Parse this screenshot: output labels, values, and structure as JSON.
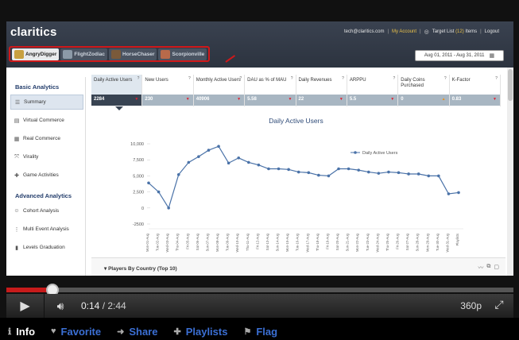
{
  "app": {
    "logo": "claritics",
    "user_email": "tech@claritics.com",
    "my_account": "My Account",
    "target_list_label": "Target List",
    "target_list_count": "(12)",
    "target_list_suffix": "Items",
    "logout": "Logout",
    "date_range": "Aug 01, 2011 - Aug 31, 2011"
  },
  "games": [
    {
      "label": "AngryDigger",
      "active": true,
      "color": "#c8a040"
    },
    {
      "label": "FlightZodiac",
      "active": false,
      "color": "#8c9aa8"
    },
    {
      "label": "HorseChaser",
      "active": false,
      "color": "#7a5a3a"
    },
    {
      "label": "Scorpionville",
      "active": false,
      "color": "#b86a4a"
    }
  ],
  "sidebar": {
    "basic_heading": "Basic Analytics",
    "basic_items": [
      {
        "label": "Summary",
        "icon": "list-icon"
      },
      {
        "label": "Virtual Commerce",
        "icon": "cart-icon"
      },
      {
        "label": "Real Commerce",
        "icon": "receipt-icon"
      },
      {
        "label": "Virality",
        "icon": "share-icon"
      },
      {
        "label": "Game Activities",
        "icon": "gamepad-icon"
      }
    ],
    "advanced_heading": "Advanced Analytics",
    "advanced_items": [
      {
        "label": "Cohort Analysis",
        "icon": "users-icon"
      },
      {
        "label": "Multi Event Analysis",
        "icon": "events-icon"
      },
      {
        "label": "Levels Graduation",
        "icon": "bars-icon"
      }
    ]
  },
  "metrics": [
    {
      "label": "Daily Active Users",
      "value": "2284",
      "trend": "down",
      "selected": true
    },
    {
      "label": "New Users",
      "value": "230",
      "trend": "down"
    },
    {
      "label": "Monthly Active Users",
      "value": "40906",
      "trend": "down"
    },
    {
      "label": "DAU as % of MAU",
      "value": "5.58",
      "trend": "down"
    },
    {
      "label": "Daily Revenues",
      "value": "22",
      "trend": "down"
    },
    {
      "label": "ARPPU",
      "value": "5.5",
      "trend": "down"
    },
    {
      "label": "Daily Coins Purchased",
      "value": "0",
      "trend": "up"
    },
    {
      "label": "K-Factor",
      "value": "0.83",
      "trend": "down"
    }
  ],
  "chart_data": {
    "type": "line",
    "title": "Daily Active Users",
    "series": [
      {
        "name": "Daily Active Users",
        "color": "#4a72a8",
        "values": [
          3900,
          2500,
          0,
          5200,
          7100,
          8000,
          9000,
          9600,
          7000,
          7800,
          7100,
          6700,
          6100,
          6100,
          6000,
          5600,
          5500,
          5100,
          5000,
          6100,
          6100,
          5900,
          5600,
          5400,
          5600,
          5500,
          5300,
          5300,
          5000,
          5000,
          2200,
          2400
        ]
      }
    ],
    "y_ticks": [
      "10,000",
      "7,500",
      "5,000",
      "2,500",
      "0",
      "-2500"
    ],
    "ylim": [
      -2500,
      10000
    ],
    "x_labels": [
      "Mon-01-Aug",
      "Tue-02-Aug",
      "Wed-03-Aug",
      "Thu-04-Aug",
      "Fri-05-Aug",
      "Sat-06-Aug",
      "Sun-07-Aug",
      "Mon-08-Aug",
      "Tue-09-Aug",
      "Wed-10-Aug",
      "Thu-11-Aug",
      "Fri-12-Aug",
      "Sat-13-Aug",
      "Sun-14-Aug",
      "Mon-15-Aug",
      "Tue-16-Aug",
      "Wed-17-Aug",
      "Thu-18-Aug",
      "Fri-19-Aug",
      "Sat-20-Aug",
      "Sun-21-Aug",
      "Mon-22-Aug",
      "Tue-23-Aug",
      "Wed-24-Aug",
      "Thu-25-Aug",
      "Fri-26-Aug",
      "Sat-27-Aug",
      "Sun-28-Aug",
      "Mon-29-Aug",
      "Tue-30-Aug",
      "Wed-31-Aug",
      "Playlists"
    ],
    "legend_position": "top-right"
  },
  "section": {
    "title": "Players By Country (Top 10)"
  },
  "player": {
    "current_time": "0:14",
    "duration": "2:44",
    "quality": "360p",
    "progress": 0.091
  },
  "actions": [
    {
      "label": "Info",
      "icon": "info-icon",
      "active": true
    },
    {
      "label": "Favorite",
      "icon": "heart-icon"
    },
    {
      "label": "Share",
      "icon": "share-arrow-icon"
    },
    {
      "label": "Playlists",
      "icon": "plus-icon"
    },
    {
      "label": "Flag",
      "icon": "flag-icon"
    }
  ]
}
